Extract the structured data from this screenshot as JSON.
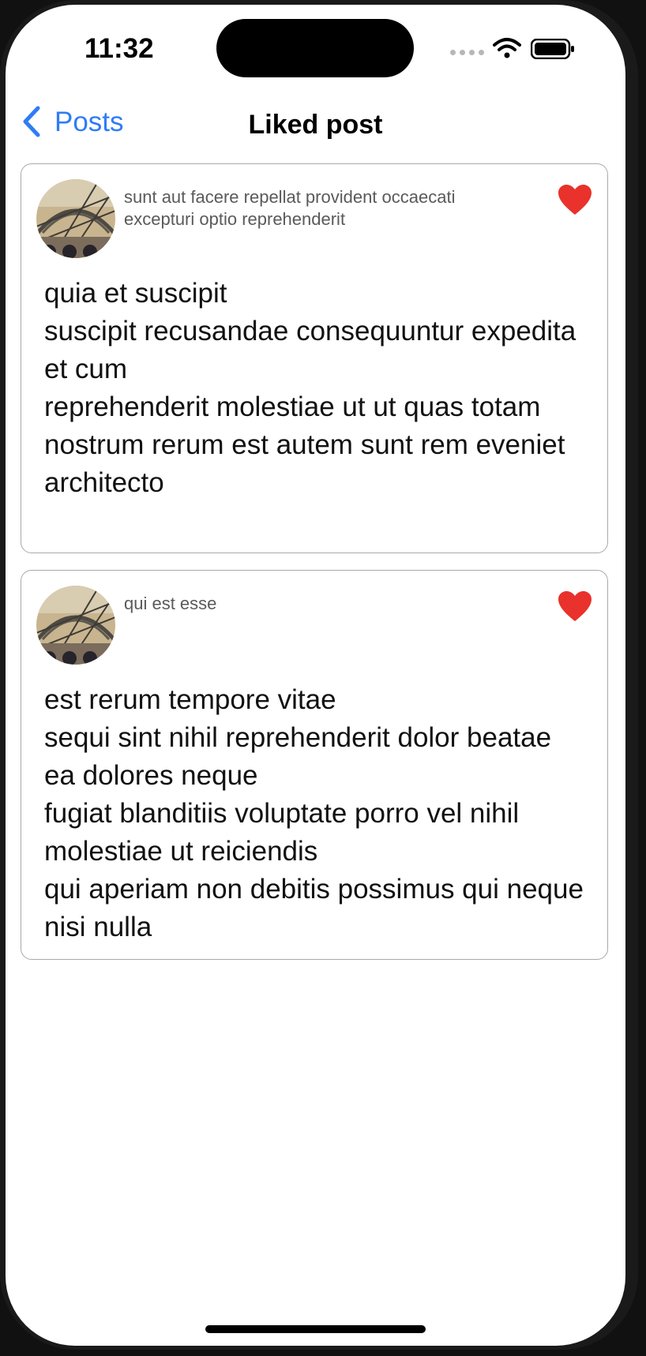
{
  "status_bar": {
    "time": "11:32"
  },
  "nav": {
    "back_label": "Posts",
    "title": "Liked post"
  },
  "posts": [
    {
      "title": "sunt aut facere repellat provident occaecati excepturi optio reprehenderit",
      "body": "quia et suscipit\nsuscipit recusandae consequuntur expedita et cum\nreprehenderit molestiae ut ut quas totam\nnostrum rerum est autem sunt rem eveniet architecto",
      "liked": true
    },
    {
      "title": "qui est esse",
      "body": "est rerum tempore vitae\nsequi sint nihil reprehenderit dolor beatae ea dolores neque\nfugiat blanditiis voluptate porro vel nihil molestiae ut reiciendis\nqui aperiam non debitis possimus qui neque nisi nulla",
      "liked": true
    }
  ],
  "icons": {
    "back": "chevron-left-icon",
    "like": "heart-icon",
    "wifi": "wifi-icon",
    "battery": "battery-icon"
  },
  "colors": {
    "accent": "#2f7cf6",
    "heart": "#e8322b",
    "card_border": "#a9a9a9",
    "title_text": "#5a5a5a"
  }
}
